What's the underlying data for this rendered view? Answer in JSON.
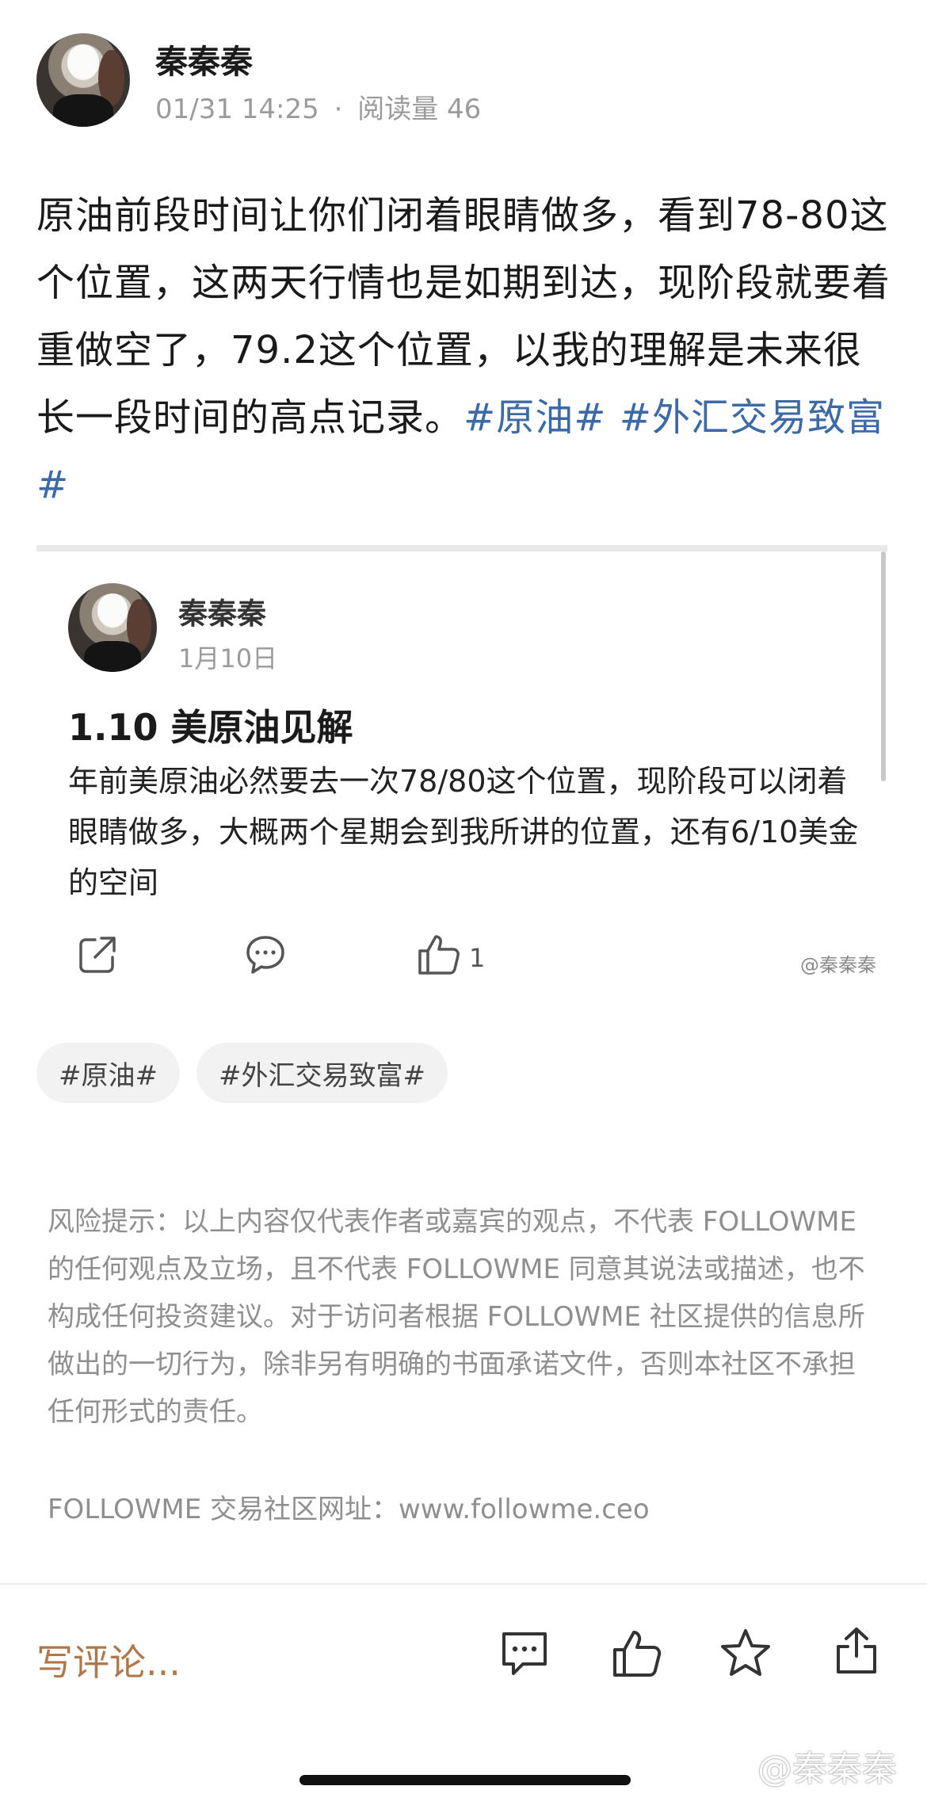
{
  "post": {
    "author": "秦秦秦",
    "date": "01/31 14:25",
    "separator": "·",
    "read_label": "阅读量 46",
    "body_text": "原油前段时间让你们闭着眼睛做多，看到78-80这个位置，这两天行情也是如期到达，现阶段就要着重做空了，79.2这个位置，以我的理解是未来很长一段时间的高点记录。",
    "inline_tags": [
      "#原油#",
      "#外汇交易致富#"
    ]
  },
  "quoted": {
    "author": "秦秦秦",
    "date": "1月10日",
    "title": "1.10 美原油见解",
    "body": "年前美原油必然要去一次78/80这个位置，现阶段可以闭着眼睛做多，大概两个星期会到我所讲的位置，还有6/10美金的空间",
    "like_count": "1",
    "watermark": "@秦秦秦",
    "icons": [
      "share-icon",
      "comment-icon",
      "like-icon"
    ]
  },
  "tags": [
    "#原油#",
    "#外汇交易致富#"
  ],
  "disclaimer": "风险提示：以上内容仅代表作者或嘉宾的观点，不代表 FOLLOWME 的任何观点及立场，且不代表 FOLLOWME 同意其说法或描述，也不构成任何投资建议。对于访问者根据 FOLLOWME 社区提供的信息所做出的一切行为，除非另有明确的书面承诺文件，否则本社区不承担任何形式的责任。",
  "site_line": "FOLLOWME 交易社区网址：www.followme.ceo",
  "bottom_bar": {
    "comment_placeholder": "写评论...",
    "icons": [
      "comment-icon",
      "like-icon",
      "favorite-star-icon",
      "share-icon"
    ]
  },
  "weibo_watermark": "@秦秦秦",
  "colors": {
    "link": "#3b6aa7",
    "comment_input": "#b0784a",
    "muted": "#9b9b9b"
  }
}
